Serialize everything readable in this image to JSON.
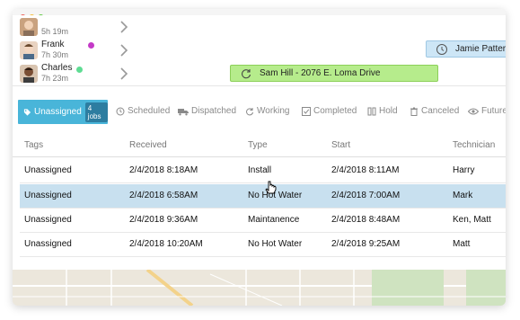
{
  "technicians": [
    {
      "name": "",
      "time": "5h 19m",
      "status_color": null
    },
    {
      "name": "Frank",
      "time": "7h 30m",
      "status_color": "#c43ac7"
    },
    {
      "name": "Charles",
      "time": "7h 23m",
      "status_color": "#5fdc93"
    }
  ],
  "timeline_jobs": {
    "frank": {
      "label": "Jamie Patter",
      "color": "#cde6f6",
      "icon": "clock-icon"
    },
    "charles": {
      "label": "Sam Hill - 2076 E. Loma Drive",
      "color": "#b6ec8c",
      "icon": "refresh-icon"
    }
  },
  "filters": {
    "active": {
      "label": "Unassigned",
      "count": "4 jobs",
      "icon": "tag-icon",
      "color": "#49b5d9"
    },
    "items": [
      {
        "label": "Scheduled",
        "icon": "clock-icon"
      },
      {
        "label": "Dispatched",
        "icon": "truck-icon"
      },
      {
        "label": "Working",
        "icon": "refresh-icon"
      },
      {
        "label": "Completed",
        "icon": "check-icon"
      },
      {
        "label": "Hold",
        "icon": "pause-icon"
      },
      {
        "label": "Canceled",
        "icon": "trash-icon"
      },
      {
        "label": "Future",
        "icon": "eye-icon"
      }
    ]
  },
  "table": {
    "columns": [
      "Tags",
      "Received",
      "Type",
      "Start",
      "Technician"
    ],
    "rows": [
      [
        "Unassigned",
        "2/4/2018  8:18AM",
        "Install",
        "2/4/2018 8:11AM",
        "Harry"
      ],
      [
        "Unassigned",
        "2/4/2018  6:58AM",
        "No Hot Water",
        "2/4/2018 7:00AM",
        "Mark"
      ],
      [
        "Unassigned",
        "2/4/2018  9:36AM",
        "Maintanence",
        "2/4/2018 8:48AM",
        "Ken, Matt"
      ],
      [
        "Unassigned",
        "2/4/2018  10:20AM",
        "No Hot Water",
        "2/4/2018 9:25AM",
        "Matt"
      ]
    ],
    "selected_row": 1
  }
}
